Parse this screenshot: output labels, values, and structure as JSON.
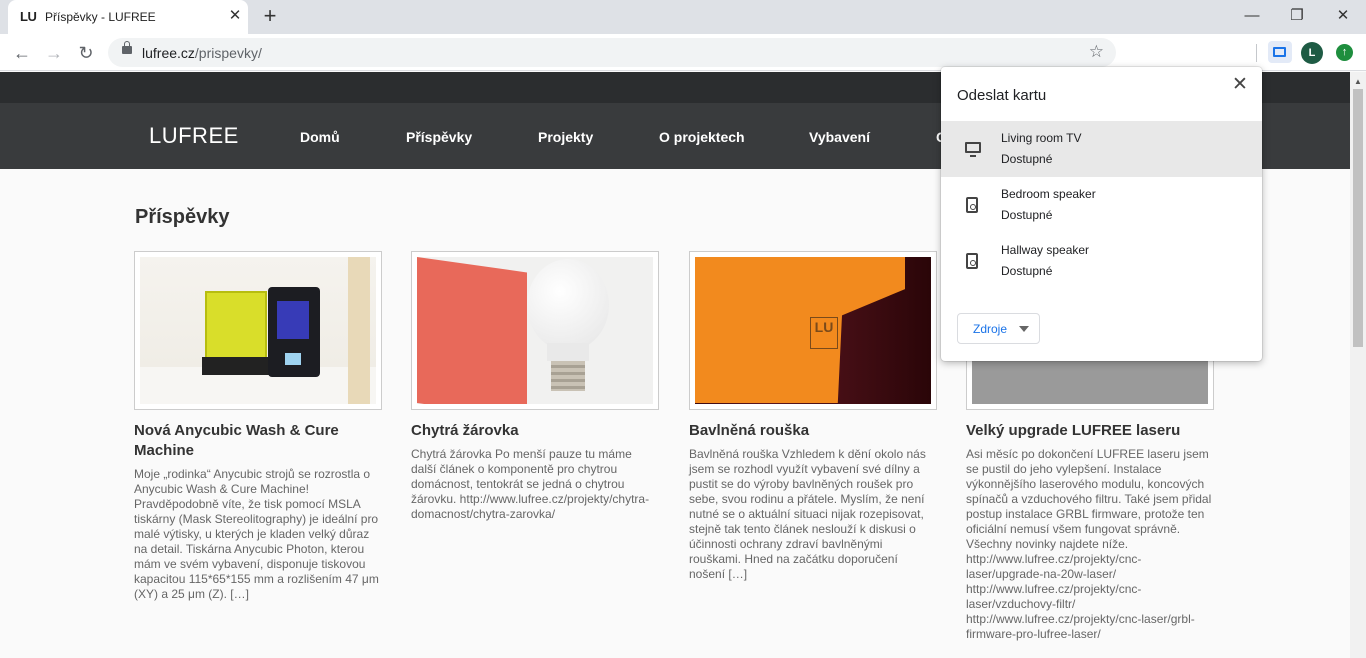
{
  "browser": {
    "tab": {
      "favicon": "LU",
      "title": "Příspěvky - LUFREE",
      "close": "✕"
    },
    "new_tab": "+",
    "window": {
      "minimize": "—",
      "restore": "❐",
      "close": "✕"
    },
    "nav": {
      "back": "←",
      "forward": "→",
      "reload": "↻"
    },
    "url": {
      "host": "lufree.cz",
      "path": "/prispevky/"
    },
    "bookmark_star": "☆",
    "profile_initial": "L",
    "update_glyph": "↑"
  },
  "site": {
    "logo": "LUFREE",
    "nav": [
      "Domů",
      "Příspěvky",
      "Projekty",
      "O projektech",
      "Vybavení",
      "C"
    ],
    "heading": "Příspěvky",
    "posts": [
      {
        "title": "Nová Anycubic Wash & Cure Machine",
        "excerpt": "Moje „rodinka“ Anycubic strojů se rozrostla o Anycubic Wash & Cure Machine! Pravděpodobně víte, že tisk pomocí MSLA tiskárny (Mask Stereolitography) je ideální pro malé výtisky, u kterých je kladen velký důraz na detail. Tiskárna Anycubic Photon, kterou mám ve svém vybavení, disponuje tiskovou kapacitou 115*65*155 mm a rozlišením 47 μm (XY) a 25 μm (Z). […]"
      },
      {
        "title": "Chytrá žárovka",
        "excerpt": "Chytrá žárovka Po menší pauze tu máme další článek o komponentě pro chytrou domácnost, tentokrát se jedná o chytrou žárovku. http://www.lufree.cz/projekty/chytra-domacnost/chytra-zarovka/"
      },
      {
        "title": "Bavlněná rouška",
        "excerpt": "Bavlněná rouška Vzhledem k dění okolo nás jsem se rozhodl využít vybavení své dílny a pustit se do výroby bavlněných roušek pro sebe, svou rodinu a přátele. Myslím, že není nutné se o aktuální situaci nijak rozepisovat, stejně tak tento článek neslouží k diskusi o účinnosti ochrany zdraví bavlněnými rouškami. Hned na začátku doporučení nošení […]"
      },
      {
        "title": "Velký upgrade LUFREE laseru",
        "excerpt": "Asi měsíc po dokončení LUFREE laseru jsem se pustil do jeho vylepšení. Instalace výkonnějšího laserového modulu, koncových spínačů a vzduchového filtru. Také jsem přidal postup instalace GRBL firmware, protože ten oficiální nemusí všem fungovat správně. Všechny novinky najdete níže. http://www.lufree.cz/projekty/cnc-laser/upgrade-na-20w-laser/ http://www.lufree.cz/projekty/cnc-laser/vzduchovy-filtr/ http://www.lufree.cz/projekty/cnc-laser/grbl-firmware-pro-lufree-laser/"
      }
    ],
    "image_marks": {
      "mask_logo": "LU"
    }
  },
  "cast": {
    "title": "Odeslat kartu",
    "close": "✕",
    "sinks": [
      {
        "name": "Living room TV",
        "status": "Dostupné",
        "icon": "tv-icon",
        "active": true
      },
      {
        "name": "Bedroom speaker",
        "status": "Dostupné",
        "icon": "speaker-icon",
        "active": false
      },
      {
        "name": "Hallway speaker",
        "status": "Dostupné",
        "icon": "speaker-icon",
        "active": false
      }
    ],
    "sources_label": "Zdroje"
  },
  "scrollbar": {
    "up_arrow": "▲"
  }
}
